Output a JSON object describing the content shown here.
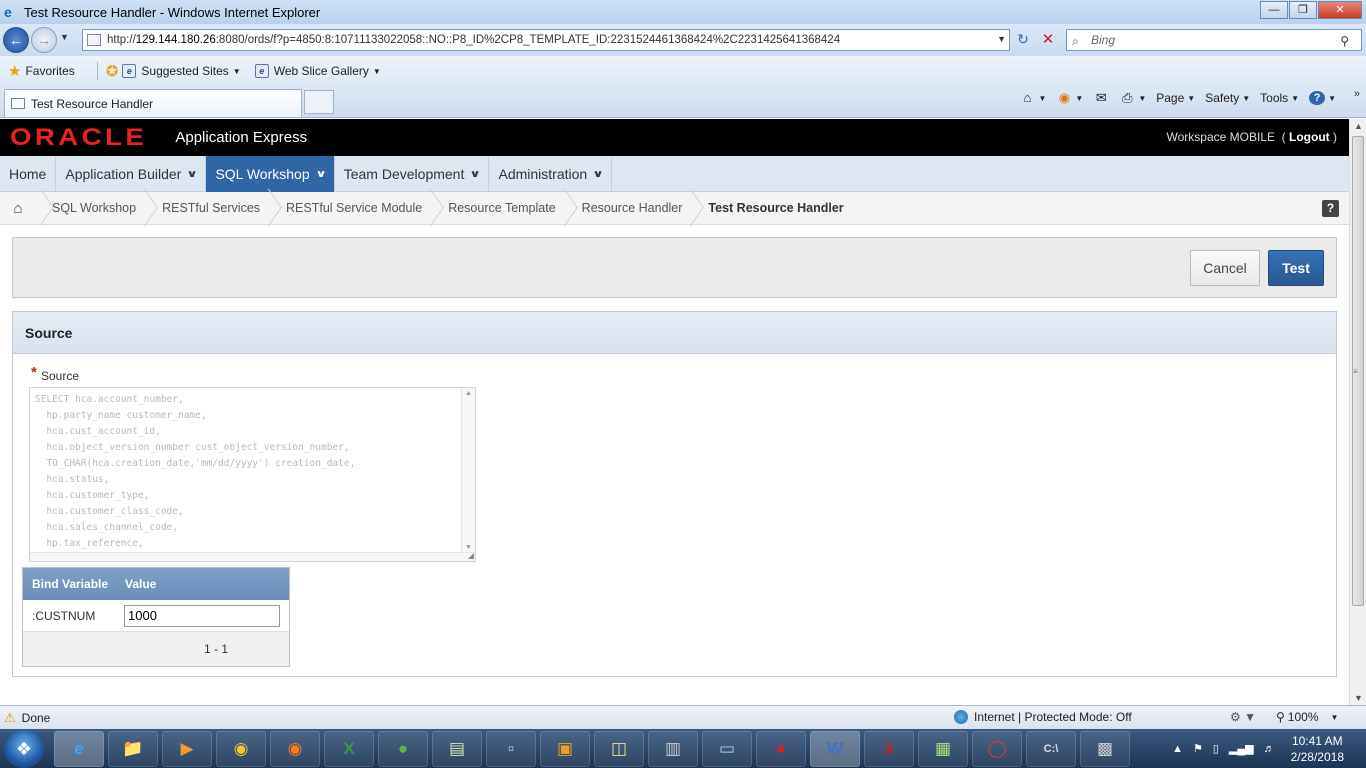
{
  "window": {
    "title": "Test Resource Handler - Windows Internet Explorer",
    "url_prefix": "http://",
    "url_host": "129.144.180.26",
    "url_rest": ":8080/ords/f?p=4850:8:10711133022058::NO::P8_ID%2CP8_TEMPLATE_ID:2231524461368424%2C2231425641368424",
    "search_placeholder": "Bing"
  },
  "favorites": {
    "favorites_label": "Favorites",
    "suggested_sites": "Suggested Sites",
    "web_slice_gallery": "Web Slice Gallery"
  },
  "tab": {
    "label": "Test Resource Handler"
  },
  "commandbar": {
    "page": "Page",
    "safety": "Safety",
    "tools": "Tools"
  },
  "apex": {
    "logo_text": "ORACLE",
    "product": "Application Express",
    "workspace": "Workspace MOBILE",
    "logout": "Logout"
  },
  "mainnav": {
    "items": [
      {
        "label": "Home"
      },
      {
        "label": "Application Builder"
      },
      {
        "label": "SQL Workshop"
      },
      {
        "label": "Team Development"
      },
      {
        "label": "Administration"
      }
    ]
  },
  "breadcrumb": {
    "items": [
      "SQL Workshop",
      "RESTful Services",
      "RESTful Service Module",
      "Resource Template",
      "Resource Handler"
    ],
    "current": "Test Resource Handler",
    "help": "?"
  },
  "buttons": {
    "cancel": "Cancel",
    "test": "Test"
  },
  "source_region": {
    "title": "Source",
    "required_mark": "*",
    "field_label": "Source",
    "code_lines": [
      "SELECT hca.account_number,",
      "  hp.party_name customer_name,",
      "  hca.cust_account_id,",
      "  hca.object_version_number cust_object_version_number,",
      "  TO_CHAR(hca.creation_date,'mm/dd/yyyy') creation_date,",
      "  hca.status,",
      "  hca.customer_type,",
      "  hca.customer_class_code,",
      "  hca.sales_channel_code,",
      "  hp.tax_reference,"
    ]
  },
  "bind_table": {
    "col_bind": "Bind Variable",
    "col_value": "Value",
    "rows": [
      {
        "name": ":CUSTNUM",
        "value": "1000"
      }
    ],
    "pager": "1 - 1"
  },
  "statusbar": {
    "status": "Done",
    "zone": "Internet | Protected Mode: Off",
    "zoom": "100%"
  },
  "taskbar": {
    "time": "10:41 AM",
    "date": "2/28/2018"
  }
}
